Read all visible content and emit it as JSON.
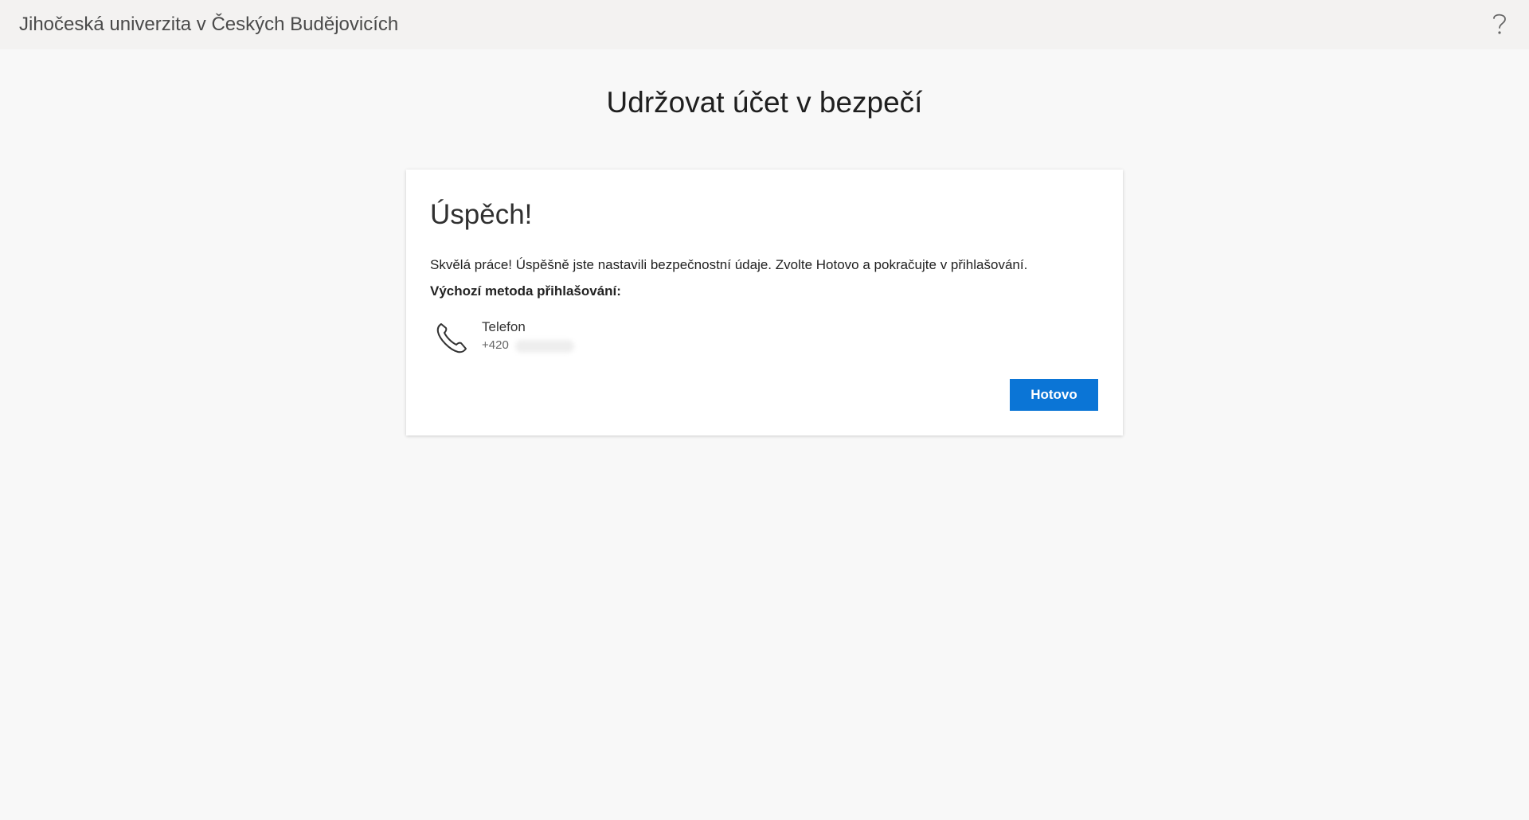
{
  "header": {
    "org_name": "Jihočeská univerzita v Českých Budějovicích",
    "help_icon": "question-mark-icon"
  },
  "page": {
    "title": "Udržovat účet v bezpečí"
  },
  "card": {
    "title": "Úspěch!",
    "message": "Skvělá práce! Úspěšně jste nastavili bezpečnostní údaje. Zvolte Hotovo a pokračujte v přihlašování.",
    "default_method_label": "Výchozí metoda přihlašování:",
    "method": {
      "icon": "phone-icon",
      "name": "Telefon",
      "number_prefix": "+420"
    },
    "done_label": "Hotovo"
  },
  "colors": {
    "accent": "#0b75d6",
    "background": "#f8f8f8",
    "topbar": "#f3f2f1"
  }
}
